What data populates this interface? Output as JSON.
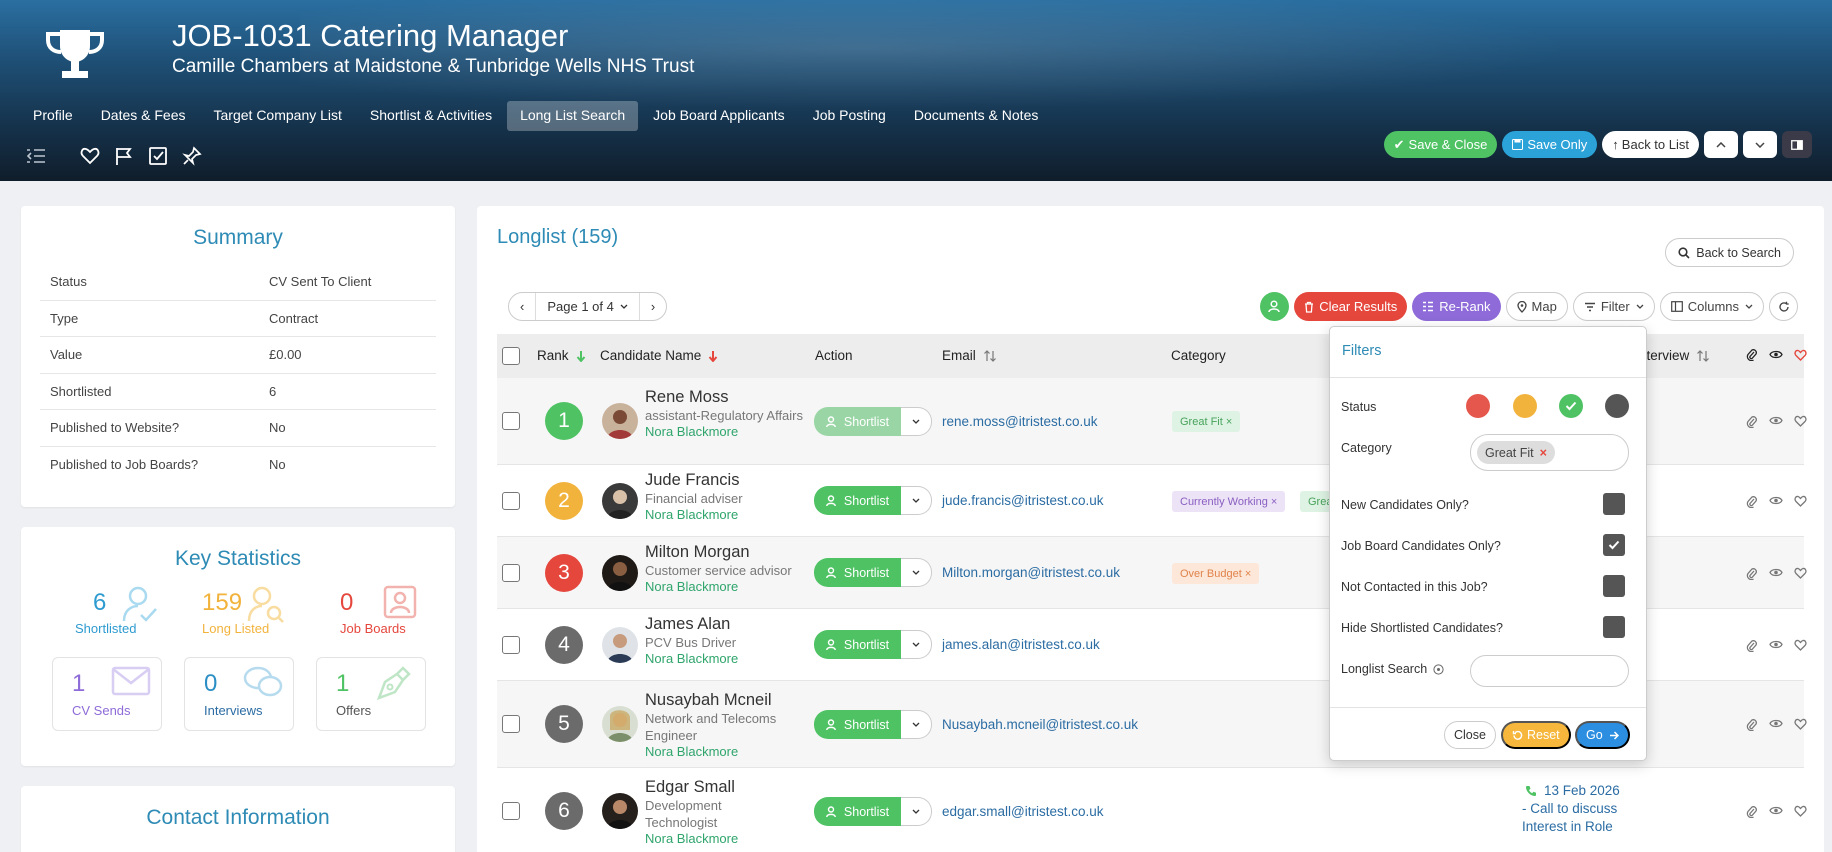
{
  "header": {
    "title": "JOB-1031 Catering Manager",
    "subtitle": "Camille Chambers at Maidstone & Tunbridge Wells NHS Trust",
    "tabs": [
      {
        "label": "Profile"
      },
      {
        "label": "Dates & Fees"
      },
      {
        "label": "Target Company List"
      },
      {
        "label": "Shortlist & Activities"
      },
      {
        "label": "Long List Search",
        "active": true
      },
      {
        "label": "Job Board Applicants"
      },
      {
        "label": "Job Posting"
      },
      {
        "label": "Documents & Notes"
      }
    ],
    "buttons": {
      "save_close": "Save & Close",
      "save_only": "Save Only",
      "back_to_list": "Back to List"
    }
  },
  "summary": {
    "title": "Summary",
    "rows": [
      {
        "label": "Status",
        "value": "CV Sent To Client"
      },
      {
        "label": "Type",
        "value": "Contract"
      },
      {
        "label": "Value",
        "value": "£0.00"
      },
      {
        "label": "Shortlisted",
        "value": "6"
      },
      {
        "label": "Published to Website?",
        "value": "No"
      },
      {
        "label": "Published to Job Boards?",
        "value": "No"
      }
    ]
  },
  "key_stats": {
    "title": "Key Statistics",
    "top": [
      {
        "value": "6",
        "label": "Shortlisted",
        "color": "#2e9bd0"
      },
      {
        "value": "159",
        "label": "Long Listed",
        "color": "#f2b33d"
      },
      {
        "value": "0",
        "label": "Job Boards",
        "color": "#e5473d"
      }
    ],
    "boxes": [
      {
        "value": "1",
        "label": "CV Sends",
        "color": "#8e6bd8"
      },
      {
        "value": "0",
        "label": "Interviews",
        "color": "#2b6ca3"
      },
      {
        "value": "1",
        "label": "Offers",
        "color": "#4fc264"
      }
    ]
  },
  "contact": {
    "title": "Contact Information"
  },
  "longlist": {
    "title": "Longlist (159)",
    "back_to_search": "Back to Search",
    "pager": {
      "prev": "‹",
      "label": "Page 1 of 4",
      "next": "›"
    },
    "toolbar": {
      "clear": "Clear Results",
      "rerank": "Re-Rank",
      "map": "Map",
      "filter": "Filter",
      "columns": "Columns"
    },
    "columns": {
      "rank": "Rank",
      "candidate_name": "Candidate Name",
      "action": "Action",
      "email": "Email",
      "category": "Category",
      "interview": "nterview"
    },
    "rows": [
      {
        "rank": "1",
        "rank_color": "#4fc264",
        "name": "Rene Moss",
        "role": "assistant-Regulatory Affairs",
        "consultant": "Nora Blackmore",
        "action": "Shortlist",
        "email": "rene.moss@itristest.co.uk",
        "tags": [
          {
            "text": "Great Fit ×",
            "style": "green"
          }
        ],
        "activity": []
      },
      {
        "rank": "2",
        "rank_color": "#f2b33d",
        "name": "Jude Francis",
        "role": "Financial adviser",
        "consultant": "Nora Blackmore",
        "action": "Shortlist",
        "email": "jude.francis@itristest.co.uk",
        "tags": [
          {
            "text": "Currently Working ×",
            "style": "purple"
          },
          {
            "text": "Grea",
            "style": "green"
          }
        ],
        "activity": []
      },
      {
        "rank": "3",
        "rank_color": "#e5473d",
        "name": "Milton Morgan",
        "role": "Customer service advisor",
        "consultant": "Nora Blackmore",
        "action": "Shortlist",
        "email": "Milton.morgan@itristest.co.uk",
        "tags": [
          {
            "text": "Over Budget ×",
            "style": "orange"
          }
        ],
        "activity": []
      },
      {
        "rank": "4",
        "rank_color": "#6b6b6b",
        "name": "James Alan",
        "role": "PCV Bus Driver",
        "consultant": "Nora Blackmore",
        "action": "Shortlist",
        "email": "james.alan@itristest.co.uk",
        "tags": [],
        "activity": []
      },
      {
        "rank": "5",
        "rank_color": "#6b6b6b",
        "name": "Nusaybah Mcneil",
        "role": "Network and Telecoms Engineer",
        "consultant": "Nora Blackmore",
        "action": "Shortlist",
        "email": "Nusaybah.mcneil@itristest.co.uk",
        "tags": [],
        "activity": []
      },
      {
        "rank": "6",
        "rank_color": "#6b6b6b",
        "name": "Edgar Small",
        "role": "Development Technologist",
        "consultant": "Nora Blackmore",
        "action": "Shortlist",
        "email": "edgar.small@itristest.co.uk",
        "tags": [],
        "activity": [
          "13 Feb 2026",
          "- Call to discuss",
          "Interest in Role"
        ]
      }
    ]
  },
  "filters": {
    "title": "Filters",
    "status_label": "Status",
    "status_colors": [
      "#e5574c",
      "#f2b33d",
      "#4fc264",
      "#555555"
    ],
    "category_label": "Category",
    "category_value": "Great Fit",
    "checkboxes": [
      {
        "label": "New Candidates Only?",
        "checked": false
      },
      {
        "label": "Job Board Candidates Only?",
        "checked": true
      },
      {
        "label": "Not Contacted in this Job?",
        "checked": false
      },
      {
        "label": "Hide Shortlisted Candidates?",
        "checked": false
      }
    ],
    "longlist_search_label": "Longlist Search",
    "longlist_search_value": "",
    "close": "Close",
    "reset": "Reset",
    "go": "Go"
  }
}
